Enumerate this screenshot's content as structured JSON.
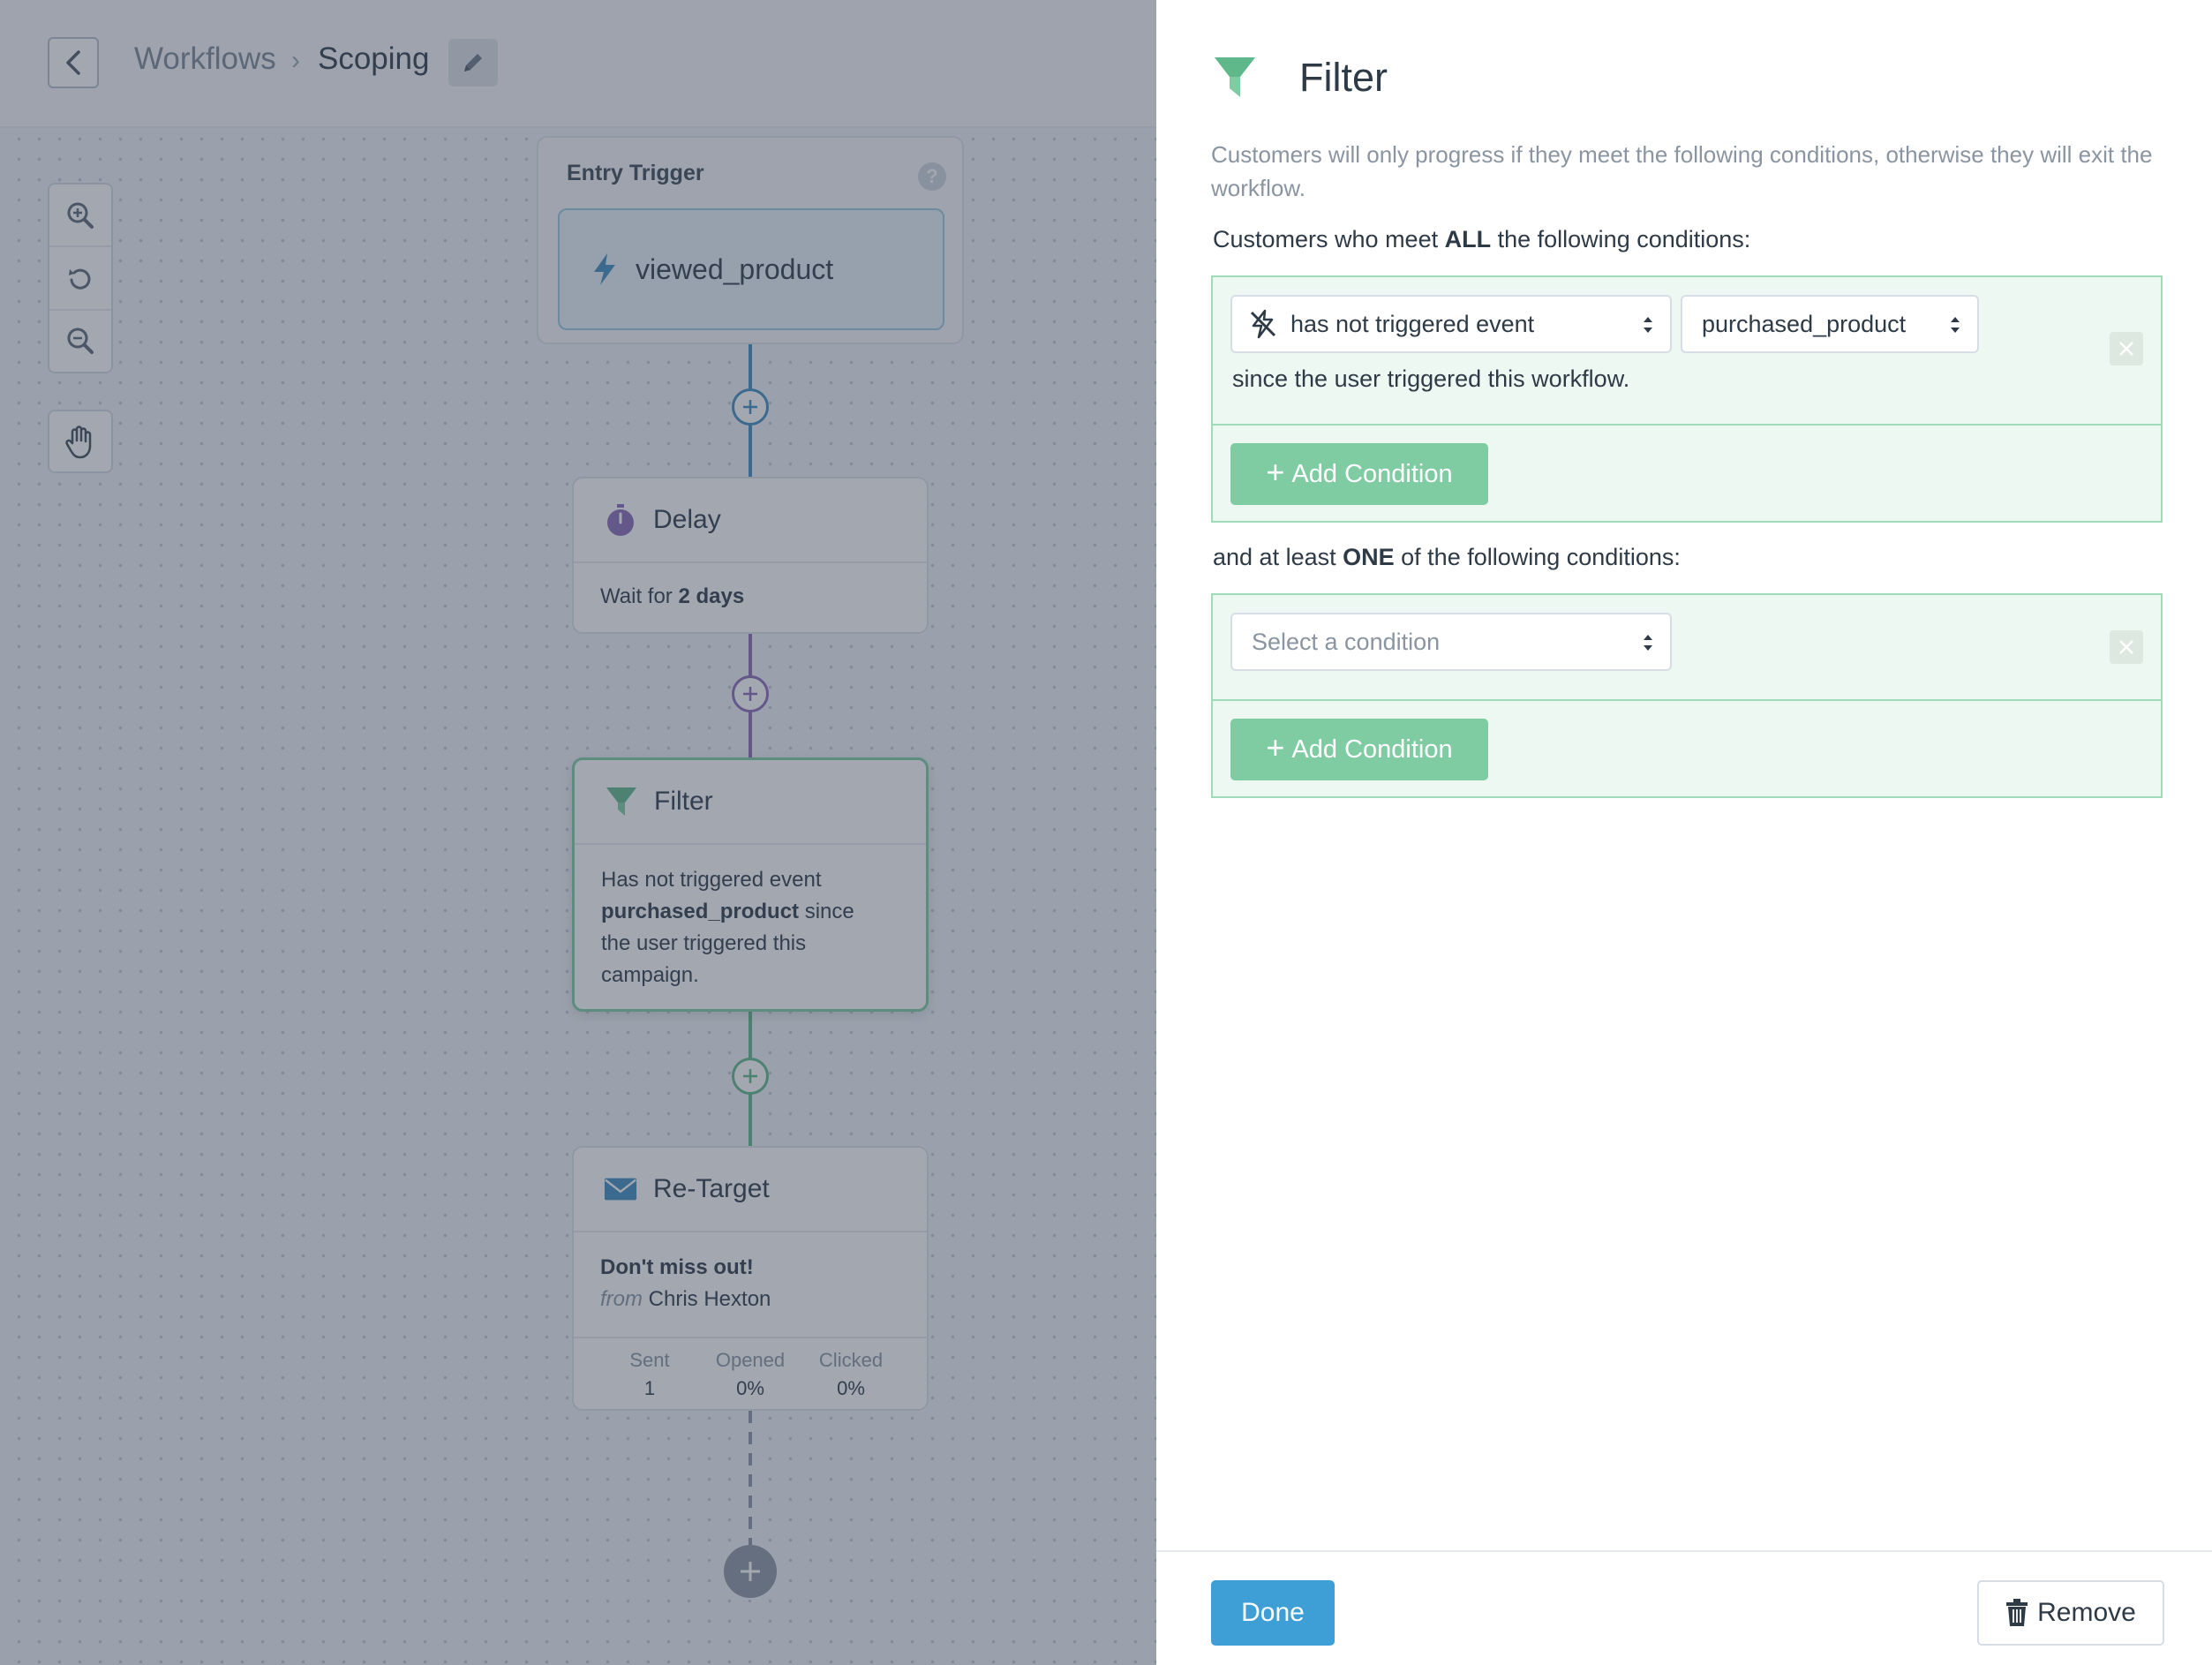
{
  "header": {
    "breadcrumb_parent": "Workflows",
    "breadcrumb_separator": "›",
    "breadcrumb_current": "Scoping"
  },
  "canvas": {
    "entry_trigger": {
      "title": "Entry Trigger",
      "help": "?",
      "event": "viewed_product"
    },
    "delay": {
      "title": "Delay",
      "body_prefix": "Wait for",
      "body_value": "2 days"
    },
    "filter": {
      "title": "Filter",
      "body_line1": "Has not triggered event",
      "body_event": "purchased_product",
      "body_since": "since",
      "body_line3": "the user triggered this",
      "body_line4": "campaign."
    },
    "retarget": {
      "title": "Re-Target",
      "subject": "Don't miss out!",
      "from_label": "from",
      "from_name": "Chris Hexton",
      "stats": [
        {
          "label": "Sent",
          "value": "1"
        },
        {
          "label": "Opened",
          "value": "0%"
        },
        {
          "label": "Clicked",
          "value": "0%"
        }
      ]
    }
  },
  "panel": {
    "title": "Filter",
    "description": "Customers will only progress if they meet the following conditions, otherwise they will exit the workflow.",
    "all_label_pre": "Customers who meet",
    "all_label_bold": "ALL",
    "all_label_post": "the following conditions:",
    "all_conditions": {
      "condition_type": "has not triggered event",
      "event": "purchased_product",
      "since_text": "since the user triggered this workflow.",
      "add_label": "Add Condition"
    },
    "one_label_pre": "and at least",
    "one_label_bold": "ONE",
    "one_label_post": "of the following conditions:",
    "one_conditions": {
      "placeholder": "Select a condition",
      "add_label": "Add Condition"
    },
    "footer": {
      "done_label": "Done",
      "remove_label": "Remove"
    }
  },
  "colors": {
    "accent_green": "#7fcca3",
    "primary_blue": "#3d9fd6",
    "delay_purple": "#8b6bb8",
    "trigger_blue": "#3f8dbf"
  }
}
